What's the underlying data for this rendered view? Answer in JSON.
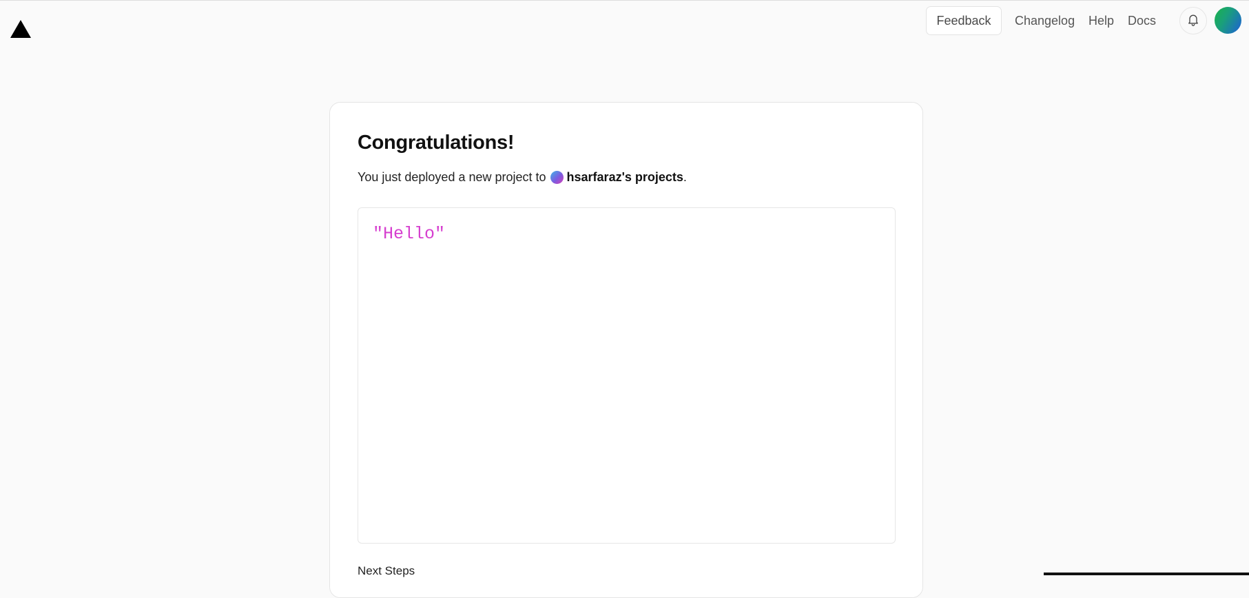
{
  "header": {
    "logo_icon": "vercel-triangle-icon",
    "feedback_label": "Feedback",
    "nav_links": [
      "Changelog",
      "Help",
      "Docs"
    ],
    "notifications_icon": "bell-icon",
    "avatar_icon": "user-avatar"
  },
  "card": {
    "title": "Congratulations!",
    "subtitle_prefix": "You just deployed a new project to",
    "team_name": "hsarfaraz's projects",
    "subtitle_suffix": ".",
    "preview_text": "\"Hello\"",
    "next_steps_label": "Next Steps"
  },
  "colors": {
    "background": "#fafafa",
    "preview_text": "#d63fcf",
    "avatar_gradient": [
      "#19b34a",
      "#1d5fd8"
    ],
    "team_dot_gradient": [
      "#3fb6e8",
      "#7c5be0",
      "#d73fb6"
    ]
  }
}
